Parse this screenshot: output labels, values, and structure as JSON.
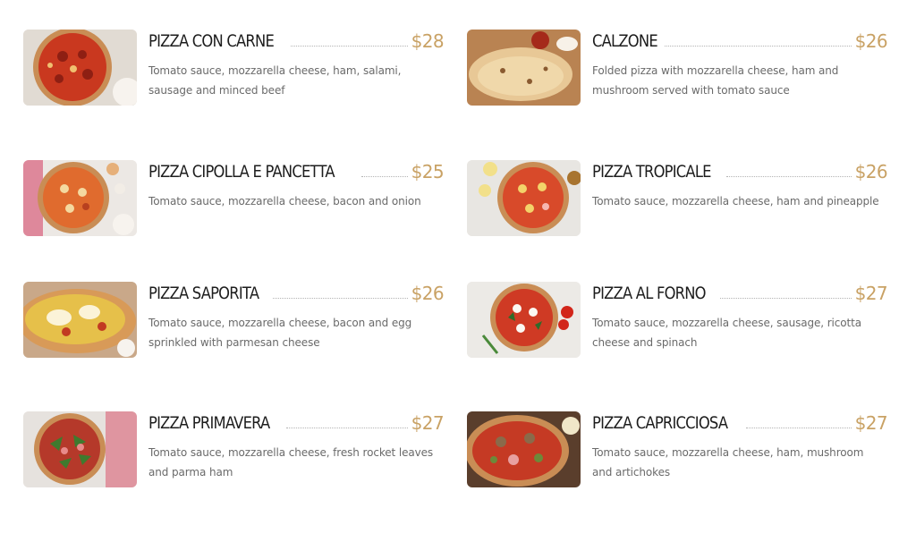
{
  "menu": {
    "items": [
      {
        "name": "PIZZA CON CARNE",
        "price": "$28",
        "description": "Tomato sauce, mozzarella cheese, ham, salami, sausage and minced beef"
      },
      {
        "name": "CALZONE",
        "price": "$26",
        "description": "Folded pizza with mozzarella cheese, ham and mushroom served with tomato sauce"
      },
      {
        "name": "PIZZA CIPOLLA E PANCETTA",
        "price": "$25",
        "description": "Tomato sauce, mozzarella cheese, bacon and onion"
      },
      {
        "name": "PIZZA TROPICALE",
        "price": "$26",
        "description": "Tomato sauce, mozzarella cheese, ham and pineapple"
      },
      {
        "name": "PIZZA SAPORITA",
        "price": "$26",
        "description": "Tomato sauce, mozzarella cheese, bacon and egg sprinkled with parmesan cheese"
      },
      {
        "name": "PIZZA AL FORNO",
        "price": "$27",
        "description": "Tomato sauce, mozzarella cheese, sausage, ricotta cheese and spinach"
      },
      {
        "name": "PIZZA PRIMAVERA",
        "price": "$27",
        "description": "Tomato sauce, mozzarella cheese, fresh rocket leaves and parma ham"
      },
      {
        "name": "PIZZA CAPRICCIOSA",
        "price": "$27",
        "description": "Tomato sauce, mozzarella cheese, ham, mushroom and artichokes"
      }
    ]
  },
  "colors": {
    "price_accent": "#c9a265",
    "title_text": "#1d1d1d",
    "description_text": "#6a6a6a"
  }
}
